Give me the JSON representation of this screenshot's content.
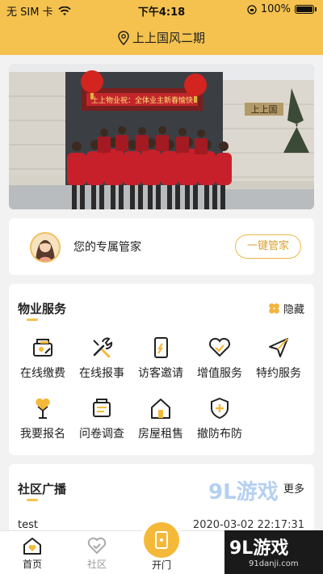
{
  "status_bar": {
    "carrier": "无 SIM 卡",
    "time": "下午4:18",
    "battery": "100%"
  },
  "header": {
    "location": "上上国风二期"
  },
  "banner": {
    "text": "上上物业祝：全体业主新春愉快",
    "building_sign": "上上国"
  },
  "butler": {
    "title": "您的专属管家",
    "button": "一键管家"
  },
  "services": {
    "title": "物业服务",
    "hide_label": "隐藏",
    "items": [
      {
        "label": "在线缴费",
        "icon": "payment-icon"
      },
      {
        "label": "在线报事",
        "icon": "wrench-icon"
      },
      {
        "label": "访客邀请",
        "icon": "visitor-icon"
      },
      {
        "label": "增值服务",
        "icon": "heart-hand-icon"
      },
      {
        "label": "特约服务",
        "icon": "send-icon"
      },
      {
        "label": "我要报名",
        "icon": "signup-icon"
      },
      {
        "label": "问卷调查",
        "icon": "survey-icon"
      },
      {
        "label": "房屋租售",
        "icon": "house-icon"
      },
      {
        "label": "撤防布防",
        "icon": "shield-icon"
      }
    ]
  },
  "community": {
    "title": "社区广播",
    "more": "更多",
    "news": [
      {
        "title": "test",
        "time": "2020-03-02 22:17:31"
      }
    ]
  },
  "tabbar": {
    "home": "首页",
    "community": "社区",
    "door": "开门"
  },
  "watermark": {
    "brand": "9L游戏",
    "site": "91danji.com",
    "float": "9L游戏"
  },
  "colors": {
    "accent": "#f5c24f",
    "text": "#222222"
  }
}
